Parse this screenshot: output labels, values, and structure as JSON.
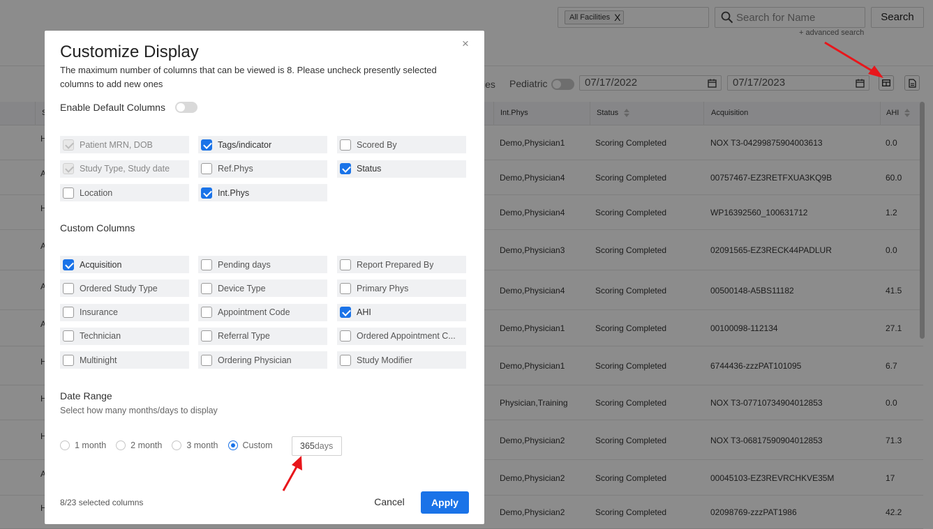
{
  "header": {
    "facility_tag": "All Facilities",
    "facility_remove": "X",
    "search_placeholder": "Search for Name",
    "search_button": "Search",
    "advanced_search": "+ advanced search"
  },
  "filters": {
    "partial_label": "ies",
    "pediatric_label": "Pediatric",
    "date_from": "07/17/2022",
    "date_to": "07/17/2023"
  },
  "table": {
    "partial_first_header": "S",
    "headers": [
      "Int.Phys",
      "Status",
      "Acquisition",
      "AHI"
    ],
    "rows": [
      {
        "c0": "H",
        "c1": "Demo,Physician1",
        "c2": "Scoring Completed",
        "c3": "NOX T3-04299875904003613",
        "c4": "0.0"
      },
      {
        "c0": "A",
        "c1": "Demo,Physician4",
        "c2": "Scoring Completed",
        "c3": "00757467-EZ3RETFXUA3KQ9B",
        "c4": "60.0"
      },
      {
        "c0": "H",
        "c1": "Demo,Physician4",
        "c2": "Scoring Completed",
        "c3": "WP16392560_100631712",
        "c4": "1.2"
      },
      {
        "c0": "A",
        "c1": "Demo,Physician3",
        "c2": "Scoring Completed",
        "c3": "02091565-EZ3RECK44PADLUR",
        "c4": "0.0"
      },
      {
        "c0": "A",
        "c1": "Demo,Physician4",
        "c2": "Scoring Completed",
        "c3": "00500148-A5BS11182",
        "c4": "41.5"
      },
      {
        "c0": "A",
        "c1": "Demo,Physician1",
        "c2": "Scoring Completed",
        "c3": "00100098-112134",
        "c4": "27.1"
      },
      {
        "c0": "H",
        "c1": "Demo,Physician1",
        "c2": "Scoring Completed",
        "c3": "6744436-zzzPAT101095",
        "c4": "6.7"
      },
      {
        "c0": "H",
        "c1": "Physician,Training",
        "c2": "Scoring Completed",
        "c3": "NOX T3-07710734904012853",
        "c4": "0.0"
      },
      {
        "c0": "H",
        "c1": "Demo,Physician2",
        "c2": "Scoring Completed",
        "c3": "NOX T3-06817590904012853",
        "c4": "71.3"
      },
      {
        "c0": "A",
        "c1": "Demo,Physician2",
        "c2": "Scoring Completed",
        "c3": "00045103-EZ3REVRCHKVE35M",
        "c4": "17"
      },
      {
        "c0": "H",
        "c1": "Demo,Physician2",
        "c2": "Scoring Completed",
        "c3": "02098769-zzzPAT1986",
        "c4": "42.2"
      }
    ]
  },
  "modal": {
    "title": "Customize Display",
    "description": "The maximum number of columns that can be viewed is 8. Please uncheck presently selected columns to add new ones",
    "close": "×",
    "enable_default_label": "Enable Default Columns",
    "default_columns": [
      {
        "label": "Patient MRN, DOB",
        "state": "disabled"
      },
      {
        "label": "Tags/indicator",
        "state": "checked"
      },
      {
        "label": "Scored By",
        "state": "unchecked"
      },
      {
        "label": "Study Type, Study date",
        "state": "disabled"
      },
      {
        "label": "Ref.Phys",
        "state": "unchecked"
      },
      {
        "label": "Status",
        "state": "checked"
      },
      {
        "label": "Location",
        "state": "unchecked"
      },
      {
        "label": "Int.Phys",
        "state": "checked"
      }
    ],
    "custom_title": "Custom Columns",
    "custom_columns": [
      {
        "label": "Acquisition",
        "state": "checked"
      },
      {
        "label": "Pending days",
        "state": "unchecked"
      },
      {
        "label": "Report Prepared By",
        "state": "unchecked"
      },
      {
        "label": "Ordered Study Type",
        "state": "unchecked"
      },
      {
        "label": "Device Type",
        "state": "unchecked"
      },
      {
        "label": "Primary Phys",
        "state": "unchecked"
      },
      {
        "label": "Insurance",
        "state": "unchecked"
      },
      {
        "label": "Appointment Code",
        "state": "unchecked"
      },
      {
        "label": "AHI",
        "state": "checked"
      },
      {
        "label": "Technician",
        "state": "unchecked"
      },
      {
        "label": "Referral Type",
        "state": "unchecked"
      },
      {
        "label": "Ordered Appointment C...",
        "state": "unchecked"
      },
      {
        "label": "Multinight",
        "state": "unchecked"
      },
      {
        "label": "Ordering Physician",
        "state": "unchecked"
      },
      {
        "label": "Study Modifier",
        "state": "unchecked"
      }
    ],
    "date_range_title": "Date Range",
    "date_range_sub": "Select how many months/days to display",
    "radios": [
      {
        "label": "1 month",
        "selected": false
      },
      {
        "label": "2 month",
        "selected": false
      },
      {
        "label": "3 month",
        "selected": false
      },
      {
        "label": "Custom",
        "selected": true
      }
    ],
    "custom_days_value": "365",
    "custom_days_unit": "days",
    "selected_count": "8/23 selected columns",
    "cancel": "Cancel",
    "apply": "Apply"
  },
  "colors": {
    "accent": "#1a73e8",
    "annotation_arrow": "#e8161b",
    "overlay": "#737373"
  }
}
